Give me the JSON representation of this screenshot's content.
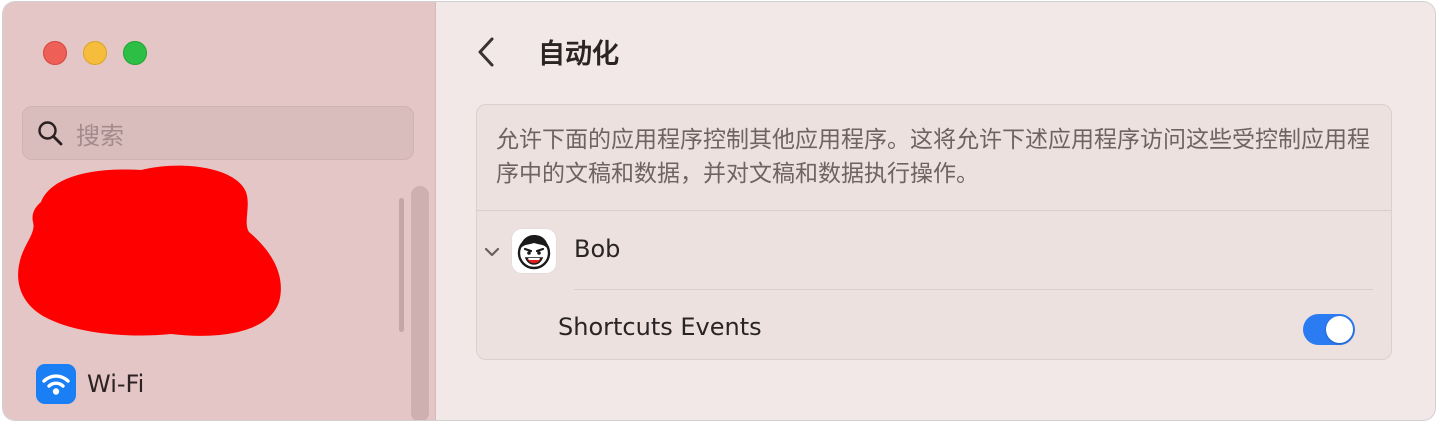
{
  "sidebar": {
    "search": {
      "placeholder": "搜索",
      "icon": "magnifying-glass"
    },
    "items": [
      {
        "label": "Wi-Fi",
        "icon": "wifi-icon",
        "icon_color": "#1a7ef5"
      }
    ]
  },
  "header": {
    "back_icon": "chevron-left",
    "title": "自动化"
  },
  "panel": {
    "description": "允许下面的应用程序控制其他应用程序。这将允许下述应用程序访问这些受控制应用程序中的文稿和数据，并对文稿和数据执行操作。",
    "apps": [
      {
        "name": "Bob",
        "expanded": true,
        "permissions": [
          {
            "label": "Shortcuts Events",
            "enabled": true
          }
        ]
      }
    ]
  },
  "colors": {
    "accent": "#2b7bf2",
    "sidebar_bg": "#e3c6c5",
    "main_bg": "#f2e8e7",
    "redaction": "#ff0000"
  }
}
